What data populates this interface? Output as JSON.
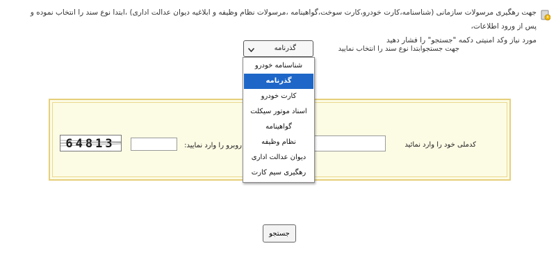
{
  "intro": {
    "line1": "جهت رهگیری مرسولات سازمانی (شناسنامه،کارت خودرو،کارت سوخت،گواهینامه ،مرسولات نظام وظیفه  و ابلاغیه دیوان عدالت اداری) ،ابتدا  نوع سند را انتخاب نموده و پس از ورود اطلاعات،",
    "line2": "مورد نیاز وکد امنیتی دکمه \"جستجو\" را فشار دهید"
  },
  "doc_type": {
    "instruction": "جهت جستجوابتدا نوع سند را انتخاب نمایید",
    "selected": "گذرنامه",
    "options": [
      "شناسنامه خودرو",
      "گذرنامه",
      "کارت خودرو",
      "اسناد موتور سیکلت",
      "گواهینامه",
      "نظام وظیفه",
      "دیوان عدالت اداری",
      "رهگیری سیم کارت"
    ]
  },
  "form": {
    "national_id_label": "کدملی خود را وارد نمائید",
    "captcha_label": "روبرو را وارد نمایید:",
    "captcha_code": "64813"
  },
  "search_button": "جستجو",
  "colors": {
    "panel_bg": "#fcfbe4",
    "panel_border": "#e6cf7a",
    "selected_option": "#1e67c8"
  },
  "icons": {
    "info": "info-icon",
    "select_arrow": "chevron-down-icon"
  }
}
